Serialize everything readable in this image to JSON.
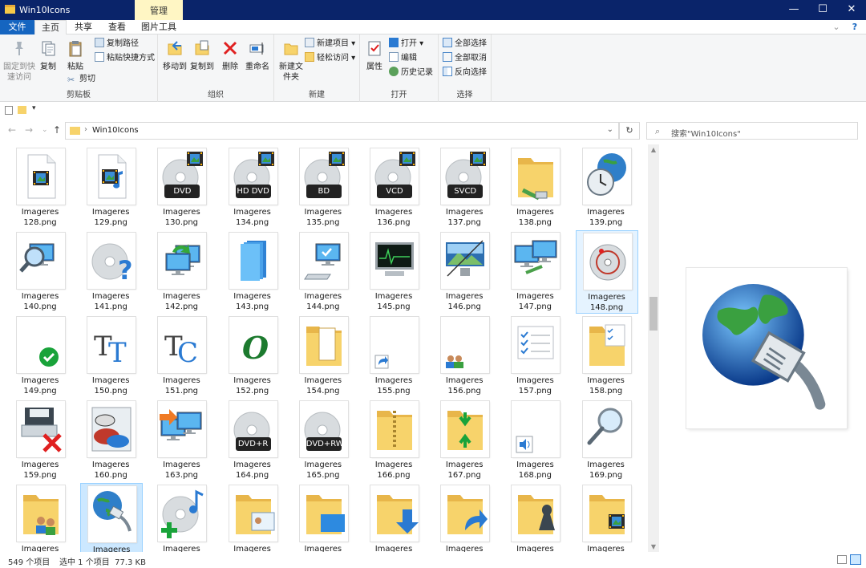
{
  "window": {
    "title": "Win10Icons",
    "context_tab": "管理",
    "minimize": "—",
    "maximize": "☐",
    "close": "✕"
  },
  "tabs": [
    "文件",
    "主页",
    "共享",
    "查看",
    "图片工具"
  ],
  "ribbon": {
    "clipboard": {
      "pin": "固定到快速访问",
      "copy": "复制",
      "paste": "粘贴",
      "copy_path": "复制路径",
      "paste_shortcut": "粘贴快捷方式",
      "cut": "剪切",
      "label": "剪贴板"
    },
    "organize": {
      "move_to": "移动到",
      "copy_to": "复制到",
      "delete": "删除",
      "rename": "重命名",
      "label": "组织"
    },
    "new": {
      "new_folder": "新建文件夹",
      "new_item": "新建项目",
      "easy_access": "轻松访问",
      "label": "新建"
    },
    "open": {
      "properties": "属性",
      "open": "打开",
      "edit": "编辑",
      "history": "历史记录",
      "label": "打开"
    },
    "select": {
      "select_all": "全部选择",
      "select_none": "全部取消",
      "invert": "反向选择",
      "label": "选择"
    }
  },
  "address": {
    "path": "Win10Icons",
    "search_placeholder": "搜索\"Win10Icons\""
  },
  "items": [
    {
      "name": "Imageres",
      "file": "128.png",
      "icon": "video-file-icon"
    },
    {
      "name": "Imageres",
      "file": "129.png",
      "icon": "music-video-file-icon"
    },
    {
      "name": "Imageres",
      "file": "130.png",
      "icon": "dvd-disc-icon",
      "badge": "DVD"
    },
    {
      "name": "Imageres",
      "file": "134.png",
      "icon": "hd-dvd-disc-icon",
      "badge": "HD DVD"
    },
    {
      "name": "Imageres",
      "file": "135.png",
      "icon": "bd-disc-icon",
      "badge": "BD"
    },
    {
      "name": "Imageres",
      "file": "136.png",
      "icon": "vcd-disc-icon",
      "badge": "VCD"
    },
    {
      "name": "Imageres",
      "file": "137.png",
      "icon": "svcd-disc-icon",
      "badge": "SVCD"
    },
    {
      "name": "Imageres",
      "file": "138.png",
      "icon": "network-folder-icon"
    },
    {
      "name": "Imageres",
      "file": "139.png",
      "icon": "globe-clock-icon"
    },
    {
      "name": "Imageres",
      "file": "140.png",
      "icon": "search-monitor-icon"
    },
    {
      "name": "Imageres",
      "file": "141.png",
      "icon": "disc-question-icon"
    },
    {
      "name": "Imageres",
      "file": "142.png",
      "icon": "monitor-restore-icon"
    },
    {
      "name": "Imageres",
      "file": "143.png",
      "icon": "blue-stack-icon"
    },
    {
      "name": "Imageres",
      "file": "144.png",
      "icon": "computer-check-icon"
    },
    {
      "name": "Imageres",
      "file": "145.png",
      "icon": "performance-monitor-icon"
    },
    {
      "name": "Imageres",
      "file": "146.png",
      "icon": "display-landscape-icon"
    },
    {
      "name": "Imageres",
      "file": "147.png",
      "icon": "two-monitors-icon"
    },
    {
      "name": "Imageres",
      "file": "148.png",
      "icon": "disc-gauge-icon"
    },
    {
      "name": "Imageres",
      "file": "149.png",
      "icon": "green-check-icon"
    },
    {
      "name": "Imageres",
      "file": "150.png",
      "icon": "font-tt-icon"
    },
    {
      "name": "Imageres",
      "file": "151.png",
      "icon": "font-tc-icon"
    },
    {
      "name": "Imageres",
      "file": "152.png",
      "icon": "font-opentype-icon"
    },
    {
      "name": "Imageres",
      "file": "154.png",
      "icon": "documents-folder-icon"
    },
    {
      "name": "Imageres",
      "file": "155.png",
      "icon": "shortcut-arrow-icon"
    },
    {
      "name": "Imageres",
      "file": "156.png",
      "icon": "users-icon"
    },
    {
      "name": "Imageres",
      "file": "157.png",
      "icon": "checklist-icon"
    },
    {
      "name": "Imageres",
      "file": "158.png",
      "icon": "checklist-folder-icon"
    },
    {
      "name": "Imageres",
      "file": "159.png",
      "icon": "drive-error-icon"
    },
    {
      "name": "Imageres",
      "file": "160.png",
      "icon": "paint-palette-icon"
    },
    {
      "name": "Imageres",
      "file": "163.png",
      "icon": "transfer-monitors-icon"
    },
    {
      "name": "Imageres",
      "file": "164.png",
      "icon": "dvd-r-disc-icon",
      "badge": "DVD+R"
    },
    {
      "name": "Imageres",
      "file": "165.png",
      "icon": "dvd-rw-disc-icon",
      "badge": "DVD+RW"
    },
    {
      "name": "Imageres",
      "file": "166.png",
      "icon": "zip-folder-icon"
    },
    {
      "name": "Imageres",
      "file": "167.png",
      "icon": "compress-folder-icon"
    },
    {
      "name": "Imageres",
      "file": "168.png",
      "icon": "speaker-icon"
    },
    {
      "name": "Imageres",
      "file": "169.png",
      "icon": "magnifier-icon"
    },
    {
      "name": "Imageres",
      "file": "",
      "icon": "users-folder-icon"
    },
    {
      "name": "Imageres",
      "file": "",
      "icon": "network-globe-icon"
    },
    {
      "name": "Imageres",
      "file": "",
      "icon": "add-music-disc-icon"
    },
    {
      "name": "Imageres",
      "file": "",
      "icon": "contacts-folder-icon"
    },
    {
      "name": "Imageres",
      "file": "",
      "icon": "desktop-folder-icon"
    },
    {
      "name": "Imageres",
      "file": "",
      "icon": "downloads-folder-icon"
    },
    {
      "name": "Imageres",
      "file": "",
      "icon": "links-folder-icon"
    },
    {
      "name": "Imageres",
      "file": "",
      "icon": "games-folder-icon"
    },
    {
      "name": "Imageres",
      "file": "",
      "icon": "videos-folder-icon"
    }
  ],
  "selected_index": 37,
  "hover_index": 17,
  "status": {
    "count": "549 个项目",
    "selection": "选中 1 个项目  77.3 KB"
  },
  "colors": {
    "titlebar": "#0a246a",
    "file_tab": "#1565c0",
    "selection": "#cce8ff",
    "folder": "#f7d36b"
  }
}
